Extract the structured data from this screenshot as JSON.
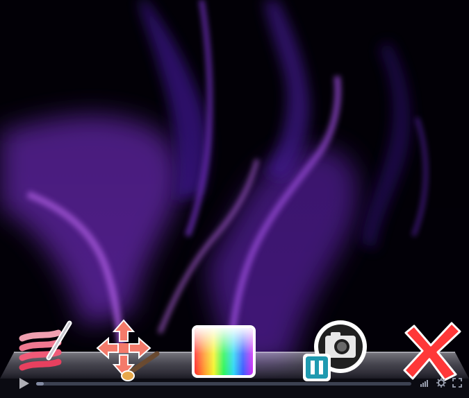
{
  "wallpaper": {
    "name": "purple smoke",
    "colors": {
      "background": "#020007",
      "smoke": "#8a3ed6",
      "smoke_highlight": "#c06cf0"
    }
  },
  "toolbar": {
    "tools": [
      {
        "id": "layers",
        "icon": "layers-brush-icon"
      },
      {
        "id": "move",
        "icon": "move-brush-icon"
      },
      {
        "id": "colors",
        "icon": "color-palette-icon"
      },
      {
        "id": "snapshot",
        "icon": "camera-pause-icon"
      },
      {
        "id": "close",
        "icon": "close-x-icon"
      }
    ]
  },
  "player": {
    "progress": 0.02,
    "icons": [
      "play-icon",
      "volume-icon",
      "settings-icon",
      "fullscreen-icon"
    ]
  }
}
